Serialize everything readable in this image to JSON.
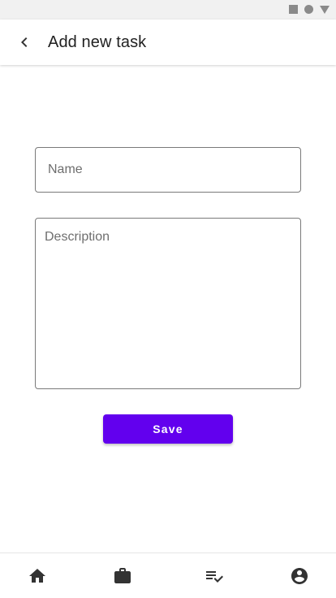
{
  "status_bar": {
    "icons": [
      "square-icon",
      "circle-icon",
      "triangle-icon"
    ]
  },
  "app_bar": {
    "back_icon": "chevron-left-icon",
    "title": "Add new task"
  },
  "form": {
    "name": {
      "placeholder": "Name",
      "value": ""
    },
    "description": {
      "placeholder": "Description",
      "value": ""
    },
    "save_label": "Save"
  },
  "bottom_nav": {
    "items": [
      {
        "icon": "home-icon"
      },
      {
        "icon": "briefcase-icon"
      },
      {
        "icon": "playlist-check-icon"
      },
      {
        "icon": "account-circle-icon"
      }
    ]
  },
  "colors": {
    "primary": "#6200ee",
    "on_primary": "#ffffff",
    "text": "#212121",
    "icon": "#333333",
    "outline": "#7a7a7a",
    "status_bar": "#f1f1f1"
  }
}
